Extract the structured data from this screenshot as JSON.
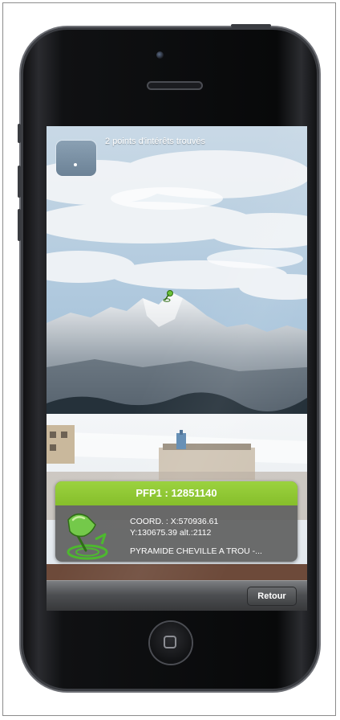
{
  "ar_view": {
    "found_text": "2 points d'intérêts trouvés",
    "thumbnail_icon": "camera-thumbnail-icon",
    "poi_marker_icon": "green-pushpin-icon"
  },
  "poi_card": {
    "title": "PFP1 : 12851140",
    "coord_line": "COORD. : X:570936.61",
    "y_alt_line": "Y:130675.39  alt.:2112",
    "description": "PYRAMIDE CHEVILLE A TROU -...",
    "icon": "green-pushpin-target-icon",
    "accent_color": "#8cc63f"
  },
  "bottom_bar": {
    "back_label": "Retour"
  },
  "device": {
    "home_button_icon": "home-square-icon"
  }
}
